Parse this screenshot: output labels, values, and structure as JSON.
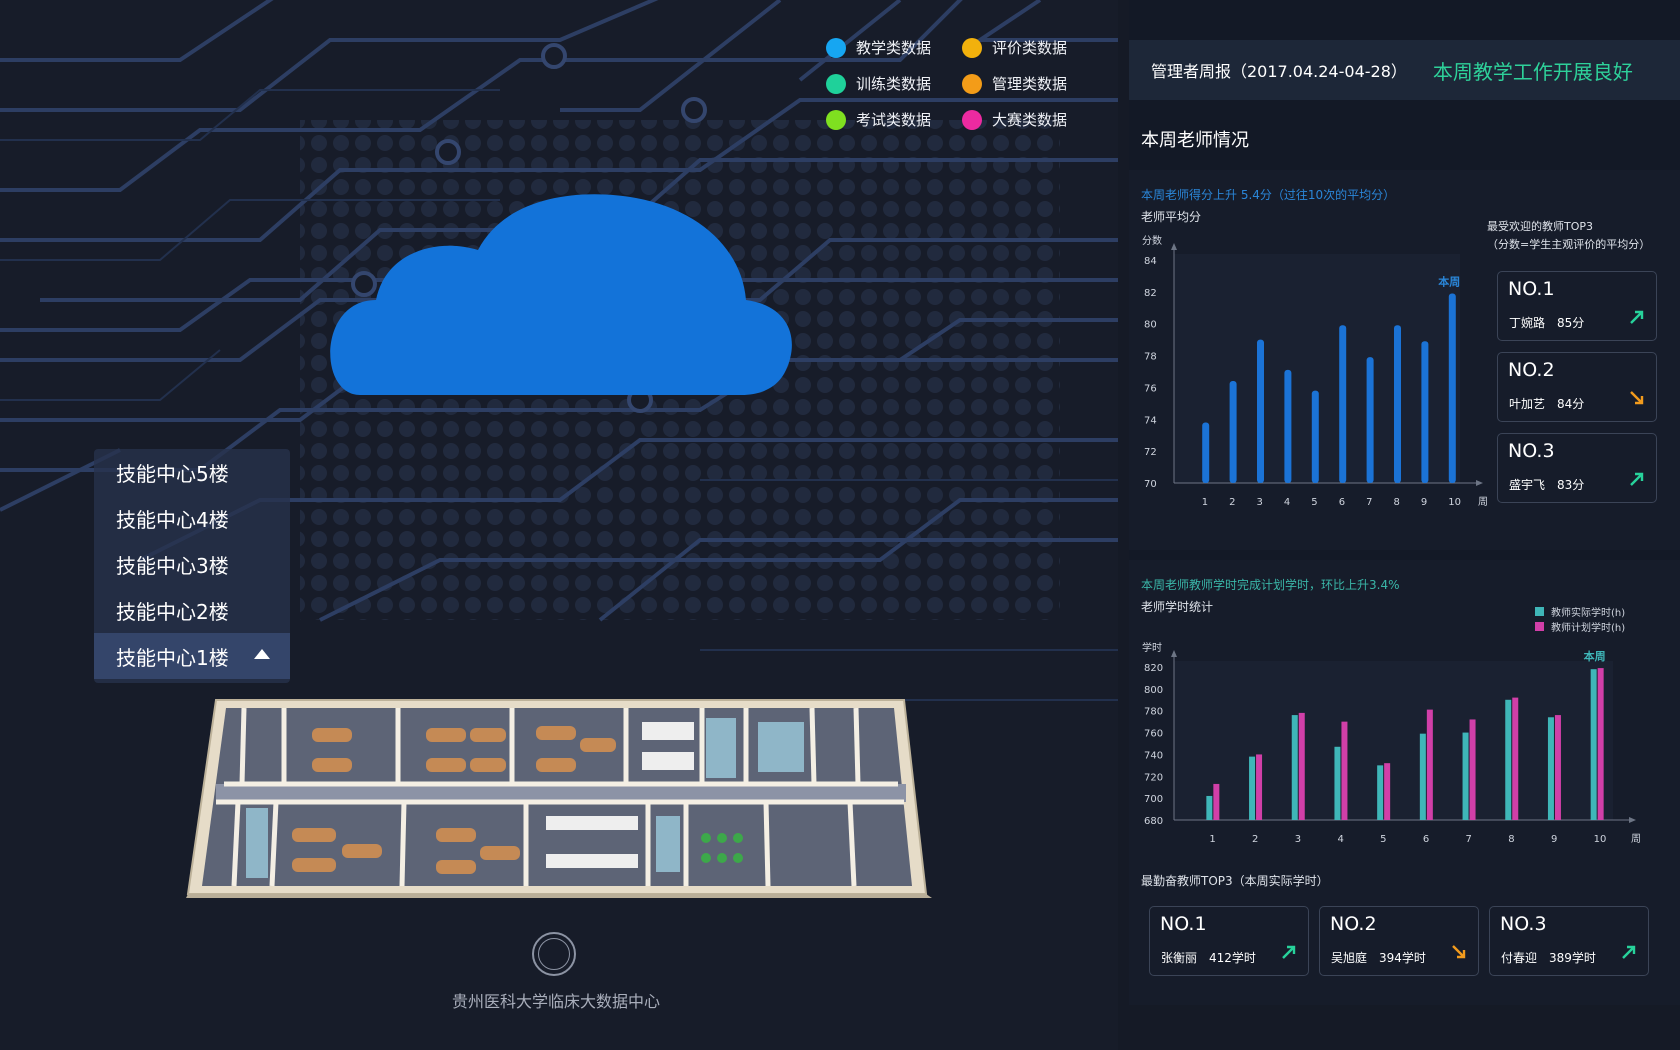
{
  "legend": [
    {
      "label": "教学类数据",
      "color": "#16a6f2"
    },
    {
      "label": "评价类数据",
      "color": "#f2b10c"
    },
    {
      "label": "训练类数据",
      "color": "#1fd19a"
    },
    {
      "label": "管理类数据",
      "color": "#f39c18"
    },
    {
      "label": "考试类数据",
      "color": "#7fe020"
    },
    {
      "label": "大赛类数据",
      "color": "#ec2aa0"
    }
  ],
  "floors": [
    "技能中心5楼",
    "技能中心4楼",
    "技能中心3楼",
    "技能中心2楼",
    "技能中心1楼"
  ],
  "footer": {
    "org_name": "贵州医科大学临床大数据中心"
  },
  "report": {
    "title": "管理者周报（2017.04.24-04-28）",
    "status": "本周教学工作开展良好"
  },
  "section_title": "本周老师情况",
  "score_chart": {
    "note": "本周老师得分上升 5.4分（过往10次的平均分）",
    "subtitle": "老师平均分",
    "ylabel": "分数",
    "xlabel": "周",
    "current_label": "本周",
    "top3_title": "最受欢迎的教师TOP3",
    "top3_caption": "（分数=学生主观评价的平均分）"
  },
  "hours_chart": {
    "note": "本周老师教师学时完成计划学时，环比上升3.4%",
    "subtitle": "老师学时统计",
    "ylabel": "学时",
    "xlabel": "周",
    "current_label": "本周",
    "series_labels": [
      "教师实际学时(h)",
      "教师计划学时(h)"
    ],
    "top3_title": "最勤奋教师TOP3（本周实际学时）"
  },
  "popular_top3": [
    {
      "rank": "NO.1",
      "name": "丁婉路",
      "value": "85分",
      "trend": "up"
    },
    {
      "rank": "NO.2",
      "name": "叶加艺",
      "value": "84分",
      "trend": "down"
    },
    {
      "rank": "NO.3",
      "name": "盛宇飞",
      "value": "83分",
      "trend": "up"
    }
  ],
  "diligent_top3": [
    {
      "rank": "NO.1",
      "name": "张衡丽",
      "value": "412学时",
      "trend": "up"
    },
    {
      "rank": "NO.2",
      "name": "吴旭庭",
      "value": "394学时",
      "trend": "down"
    },
    {
      "rank": "NO.3",
      "name": "付春迎",
      "value": "389学时",
      "trend": "up"
    }
  ],
  "chart_data": [
    {
      "type": "bar",
      "subtitle": "老师平均分",
      "xlabel": "周",
      "ylabel": "分数",
      "categories": [
        "1",
        "2",
        "3",
        "4",
        "5",
        "6",
        "7",
        "8",
        "9",
        "10"
      ],
      "values": [
        73.8,
        76.4,
        79.0,
        77.1,
        75.8,
        79.9,
        77.9,
        79.9,
        78.9,
        81.9
      ],
      "ylim": [
        70,
        84
      ],
      "yticks": [
        70,
        72,
        74,
        76,
        78,
        80,
        82,
        84
      ],
      "annotation": "本周",
      "color": "#1b73d6"
    },
    {
      "type": "bar",
      "subtitle": "老师学时统计",
      "xlabel": "周",
      "ylabel": "学时",
      "categories": [
        "1",
        "2",
        "3",
        "4",
        "5",
        "6",
        "7",
        "8",
        "9",
        "10"
      ],
      "series": [
        {
          "name": "教师实际学时(h)",
          "color": "#3fb6b8",
          "values": [
            702,
            738,
            776,
            747,
            730,
            759,
            760,
            790,
            774,
            818
          ]
        },
        {
          "name": "教师计划学时(h)",
          "color": "#d13fa8",
          "values": [
            713,
            740,
            778,
            770,
            732,
            781,
            772,
            792,
            776,
            819
          ]
        }
      ],
      "ylim": [
        680,
        820
      ],
      "yticks": [
        680,
        700,
        720,
        740,
        760,
        780,
        800,
        820
      ],
      "annotation": "本周",
      "legend": "top-right"
    }
  ]
}
